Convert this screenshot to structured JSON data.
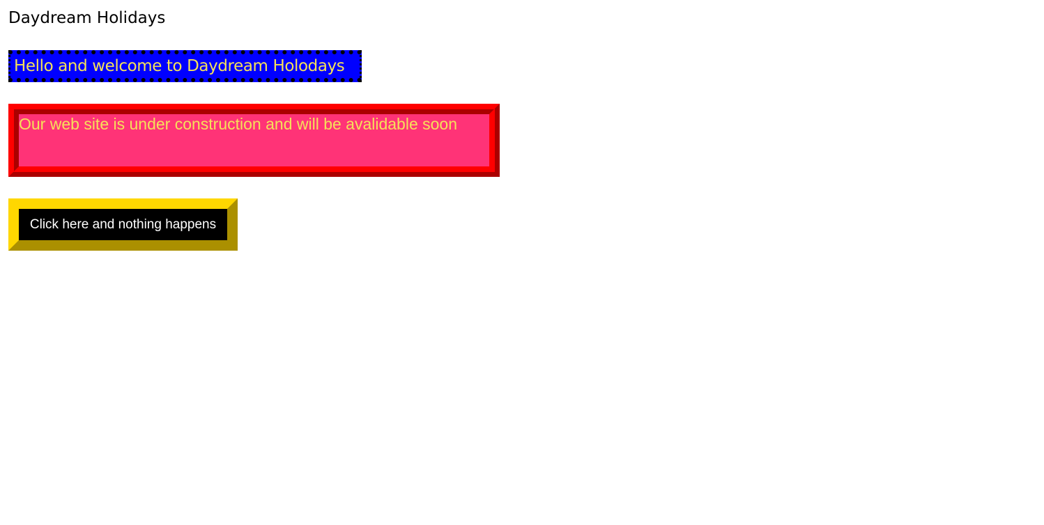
{
  "page": {
    "title": "Daydream Holidays"
  },
  "banner": {
    "welcome_text": "Hello and welcome to Daydream Holodays"
  },
  "notice": {
    "text": "Our web site is under construction and will be avalidable soon"
  },
  "button": {
    "label": "Click here and nothing happens"
  },
  "colors": {
    "banner_background": "#0000ff",
    "banner_text": "#f5e05a",
    "notice_background": "#ff3377",
    "notice_border": "#ff0000",
    "button_background": "#000000",
    "button_border": "#ffd700",
    "button_text": "#ffffff"
  }
}
